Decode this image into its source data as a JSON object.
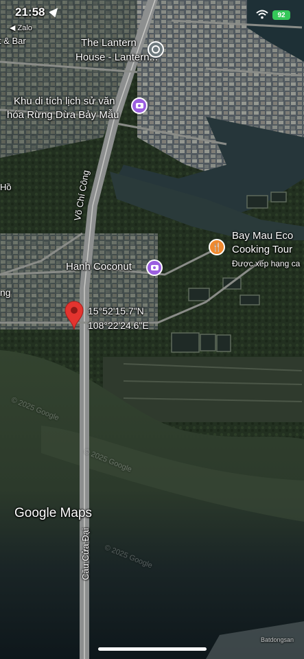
{
  "status_bar": {
    "time": "21:58",
    "back_app": "◀ Zalo",
    "battery": "92"
  },
  "map": {
    "places": [
      {
        "name": "The Lantern",
        "name2": "House - Lantern...",
        "icon": "pin-icon"
      },
      {
        "name": "Khu di tích lịch sử văn",
        "name2": "hóa Rừng Dừa Bảy Mẫu",
        "icon": "camera-icon"
      },
      {
        "name": "Bay Mau Eco",
        "name2": "Cooking Tour",
        "sub": "Được xếp hạng ca",
        "icon": "restaurant-icon"
      },
      {
        "name": "Hanh Coconut",
        "icon": "camera-icon"
      }
    ],
    "edge_labels": {
      "top_left": "t & Bar",
      "left_mid": "Hồ",
      "left_low": "ng"
    },
    "roads": {
      "main": "Võ Chí Công",
      "bridge": "Cầu Cửa Đại"
    },
    "dropped_pin": {
      "lat": "15°52'15.7\"N",
      "lon": "108°22'24.6\"E"
    },
    "logo": "Google Maps",
    "watermarks": [
      "© 2025 Google",
      "© 2025 Google",
      "© 2025 Google"
    ],
    "corner_watermark": "Batdongsan"
  },
  "colors": {
    "water_dark": "#0f1a1c",
    "water_green": "#3a4a33",
    "land": "#2c3526",
    "poi_purple": "#9b5fe0",
    "poi_orange": "#f0892e",
    "poi_grey": "#6e7a7e",
    "pin_red": "#e3342f"
  }
}
